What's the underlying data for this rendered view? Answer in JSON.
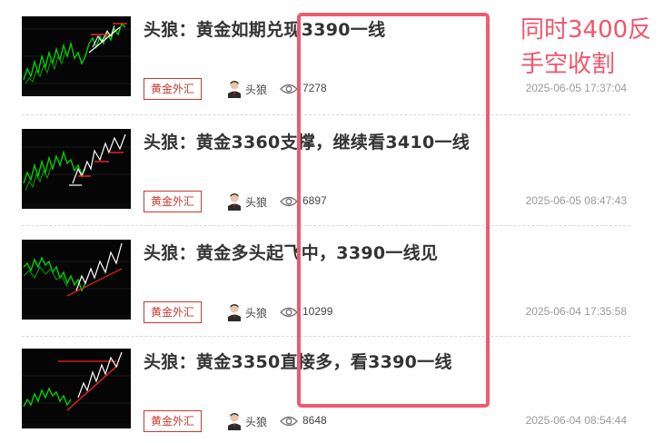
{
  "articles": [
    {
      "title": "头狼：黄金如期兑现3390一线",
      "tag": "黄金外汇",
      "author": "头狼",
      "views": "7278",
      "date": "2025-06-05 17:37:04"
    },
    {
      "title": "头狼：黄金3360支撑，继续看3410一线",
      "tag": "黄金外汇",
      "author": "头狼",
      "views": "6897",
      "date": "2025-06-05 08:47:43"
    },
    {
      "title": "头狼：黄金多头起飞中，3390一线见",
      "tag": "黄金外汇",
      "author": "头狼",
      "views": "10299",
      "date": "2025-06-04 17:35:58"
    },
    {
      "title": "头狼：黄金3350直接多，看3390一线",
      "tag": "黄金外汇",
      "author": "头狼",
      "views": "8648",
      "date": "2025-06-04 08:54:44"
    }
  ],
  "annotation": {
    "line1": "同时3400反",
    "line2": "手空收割",
    "color": "#f0556a"
  },
  "colors": {
    "tag": "#c8392f",
    "highlight": "#ef5b6e",
    "candle_up": "#00cc00"
  }
}
